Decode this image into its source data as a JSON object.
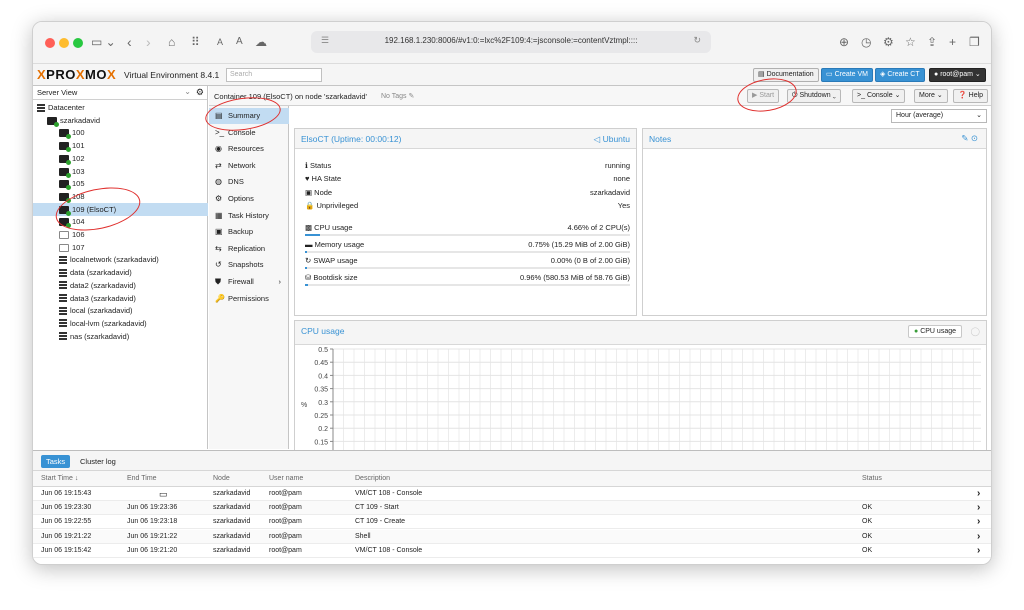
{
  "browser": {
    "url": "192.168.1.230:8006/#v1:0:=lxc%2F109:4:=jsconsole:=contentVztmpl::::",
    "icons": [
      "sidebar-icon",
      "back-icon",
      "forward-icon",
      "home-icon",
      "grid-icon",
      "text-size-icon",
      "cloud-icon",
      "download-icon",
      "history-icon",
      "settings-icon",
      "star-icon",
      "share-icon",
      "new-tab-icon",
      "tabs-icon"
    ]
  },
  "pve": {
    "logo_pro": "PRO",
    "logo_mo": "MO",
    "logo_x": "X",
    "ve_label": "Virtual Environment 8.4.1",
    "search_placeholder": "Search",
    "documentation": "Documentation",
    "create_vm": "Create VM",
    "create_ct": "Create CT",
    "user": "root@pam"
  },
  "tree": {
    "view": "Server View",
    "items": [
      {
        "label": "Datacenter",
        "type": "datacenter"
      },
      {
        "label": "szarkadavid",
        "type": "node"
      },
      {
        "label": "100",
        "type": "ct-run"
      },
      {
        "label": "101",
        "type": "ct-run"
      },
      {
        "label": "102",
        "type": "ct-run"
      },
      {
        "label": "103",
        "type": "ct-run"
      },
      {
        "label": "105",
        "type": "ct-run"
      },
      {
        "label": "108",
        "type": "ct-run"
      },
      {
        "label": "109 (ElsoCT)",
        "type": "ct-run",
        "selected": true
      },
      {
        "label": "104",
        "type": "vm-run"
      },
      {
        "label": "106",
        "type": "ct-off"
      },
      {
        "label": "107",
        "type": "ct-off"
      },
      {
        "label": "localnetwork (szarkadavid)",
        "type": "net"
      },
      {
        "label": "data (szarkadavid)",
        "type": "storage"
      },
      {
        "label": "data2 (szarkadavid)",
        "type": "storage"
      },
      {
        "label": "data3 (szarkadavid)",
        "type": "storage"
      },
      {
        "label": "local (szarkadavid)",
        "type": "storage"
      },
      {
        "label": "local-lvm (szarkadavid)",
        "type": "storage"
      },
      {
        "label": "nas (szarkadavid)",
        "type": "storage"
      }
    ]
  },
  "content_header": {
    "title": "Container 109 (ElsoCT) on node 'szarkadavid'",
    "no_tags": "No Tags",
    "start": "Start",
    "shutdown": "Shutdown",
    "console": "Console",
    "more": "More",
    "help": "Help"
  },
  "menu": [
    {
      "label": "Summary",
      "glyph": "▤",
      "active": true
    },
    {
      "label": "Console",
      "glyph": ">_"
    },
    {
      "label": "Resources",
      "glyph": "◉"
    },
    {
      "label": "Network",
      "glyph": "⇄"
    },
    {
      "label": "DNS",
      "glyph": "◍"
    },
    {
      "label": "Options",
      "glyph": "⚙"
    },
    {
      "label": "Task History",
      "glyph": "▦"
    },
    {
      "label": "Backup",
      "glyph": "▣"
    },
    {
      "label": "Replication",
      "glyph": "⇆"
    },
    {
      "label": "Snapshots",
      "glyph": "↺"
    },
    {
      "label": "Firewall",
      "glyph": "⛊",
      "arrow": "›"
    },
    {
      "label": "Permissions",
      "glyph": "🔑"
    }
  ],
  "summary": {
    "timeframe": "Hour (average)",
    "panel_title": "ElsoCT (Uptime: 00:00:12)",
    "os": "Ubuntu",
    "notes_title": "Notes",
    "rows": [
      {
        "key": "Status",
        "value": "running",
        "glyph": "ℹ"
      },
      {
        "key": "HA State",
        "value": "none",
        "glyph": "♥"
      },
      {
        "key": "Node",
        "value": "szarkadavid",
        "glyph": "▣"
      },
      {
        "key": "Unprivileged",
        "value": "Yes",
        "glyph": "🔒"
      }
    ],
    "usage": [
      {
        "key": "CPU usage",
        "value": "4.66% of 2 CPU(s)",
        "glyph": "▩",
        "fraction": 0.0466
      },
      {
        "key": "Memory usage",
        "value": "0.75% (15.29 MiB of 2.00 GiB)",
        "glyph": "▬",
        "fraction": 0.0075
      },
      {
        "key": "SWAP usage",
        "value": "0.00% (0 B of 2.00 GiB)",
        "glyph": "↻",
        "fraction": 0.0
      },
      {
        "key": "Bootdisk size",
        "value": "0.96% (580.53 MiB of 58.76 GiB)",
        "glyph": "⛁",
        "fraction": 0.0096
      }
    ]
  },
  "cpu_chart": {
    "title": "CPU usage",
    "legend": "CPU usage",
    "axis_unit": "%",
    "ticks": [
      "0.5",
      "0.45",
      "0.4",
      "0.35",
      "0.3",
      "0.25",
      "0.2",
      "0.15"
    ]
  },
  "tasks": {
    "tabs": [
      "Tasks",
      "Cluster log"
    ],
    "columns": [
      "Start Time ↓",
      "End Time",
      "Node",
      "User name",
      "Description",
      "Status"
    ],
    "rows": [
      {
        "start": "Jun 06 19:15:43",
        "end": "",
        "end_icon": "monitor-icon",
        "node": "szarkadavid",
        "user": "root@pam",
        "desc": "VM/CT 108 - Console",
        "status": ""
      },
      {
        "start": "Jun 06 19:23:30",
        "end": "Jun 06 19:23:36",
        "node": "szarkadavid",
        "user": "root@pam",
        "desc": "CT 109 - Start",
        "status": "OK"
      },
      {
        "start": "Jun 06 19:22:55",
        "end": "Jun 06 19:23:18",
        "node": "szarkadavid",
        "user": "root@pam",
        "desc": "CT 109 - Create",
        "status": "OK"
      },
      {
        "start": "Jun 06 19:21:22",
        "end": "Jun 06 19:21:22",
        "node": "szarkadavid",
        "user": "root@pam",
        "desc": "Shell",
        "status": "OK"
      },
      {
        "start": "Jun 06 19:15:42",
        "end": "Jun 06 19:21:20",
        "node": "szarkadavid",
        "user": "root@pam",
        "desc": "VM/CT 108 - Console",
        "status": "OK"
      }
    ]
  },
  "colors": {
    "accent": "#3892d4",
    "annotation": "#e0302e",
    "running": "#2ca02c",
    "brand": "#e57000"
  }
}
